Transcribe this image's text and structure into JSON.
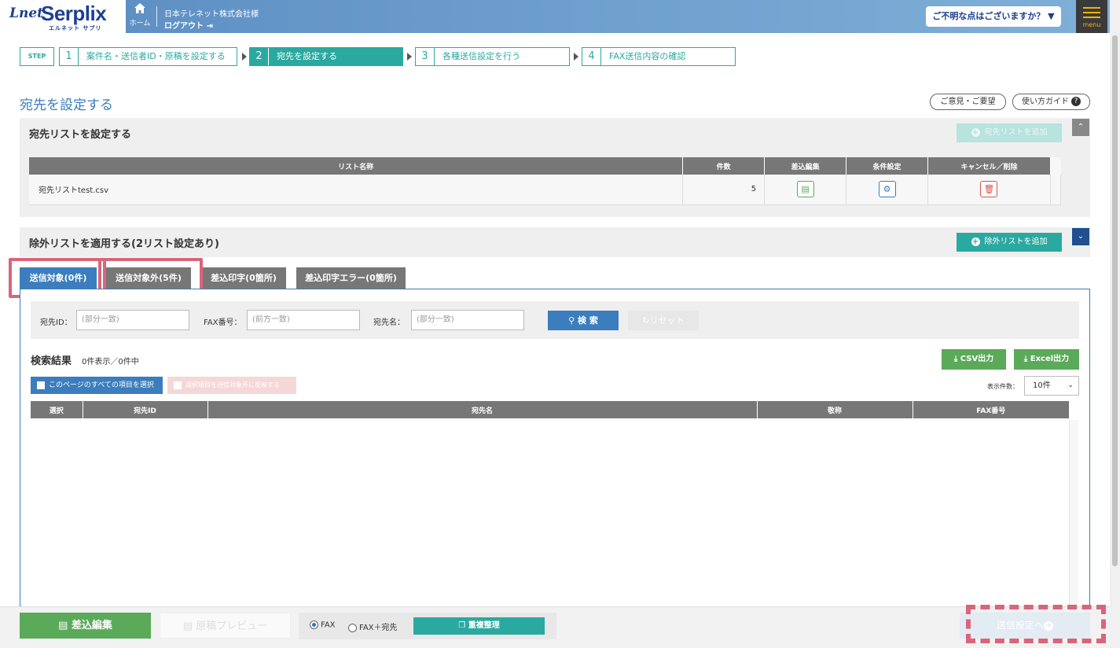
{
  "header": {
    "logo_lnet": "Lnet",
    "logo_brand": "Serplix",
    "logo_sub": "エルネット サプリ",
    "home_label": "ホーム",
    "company": "日本テレネット株式会社様",
    "logout": "ログアウト",
    "help": "ご不明な点はございますか？ ▼",
    "menu": "menu"
  },
  "steps": {
    "tag": "STEP",
    "items": [
      {
        "num": "1",
        "label": "案件名・送信者ID・原稿を設定する"
      },
      {
        "num": "2",
        "label": "宛先を設定する"
      },
      {
        "num": "3",
        "label": "各種送信設定を行う"
      },
      {
        "num": "4",
        "label": "FAX送信内容の確認"
      }
    ]
  },
  "page": {
    "title": "宛先を設定する",
    "feedback": "ご意見・ご要望",
    "guide": "使い方ガイド"
  },
  "dest_list": {
    "title": "宛先リストを設定する",
    "add_btn": "宛先リストを追加",
    "columns": [
      "リスト名称",
      "件数",
      "差込編集",
      "条件設定",
      "キャンセル／削除"
    ],
    "rows": [
      {
        "name": "宛先リストtest.csv",
        "count": "5"
      }
    ]
  },
  "exclude_list": {
    "title": "除外リストを適用する(2リスト設定あり)",
    "add_btn": "除外リストを追加"
  },
  "tabs": [
    "送信対象(0件)",
    "送信対象外(5件)",
    "差込印字(0箇所)",
    "差込印字エラー(0箇所)"
  ],
  "search": {
    "id_label": "宛先ID：",
    "id_placeholder": "(部分一致)",
    "fax_label": "FAX番号：",
    "fax_placeholder": "(前方一致)",
    "name_label": "宛先名：",
    "name_placeholder": "(部分一致)",
    "search_btn": "検 索",
    "reset_btn": "リセット"
  },
  "results": {
    "title": "検索結果",
    "count": "0件表示／0件中",
    "csv_btn": "CSV出力",
    "excel_btn": "Excel出力",
    "select_all": "このページのすべての項目を選択",
    "exclude_selected": "選択項目を送信対象外に反映する",
    "per_page_label": "表示件数：",
    "per_page_value": "10件",
    "columns": [
      "選択",
      "宛先ID",
      "宛先名",
      "敬称",
      "FAX番号"
    ]
  },
  "footer": {
    "merge_btn": "差込編集",
    "preview_btn": "原稿プレビュー",
    "radio_fax": "FAX",
    "radio_fax_dest": "FAX＋宛先",
    "dedupe_btn": "重複整理",
    "next_btn": "送信設定へ"
  }
}
